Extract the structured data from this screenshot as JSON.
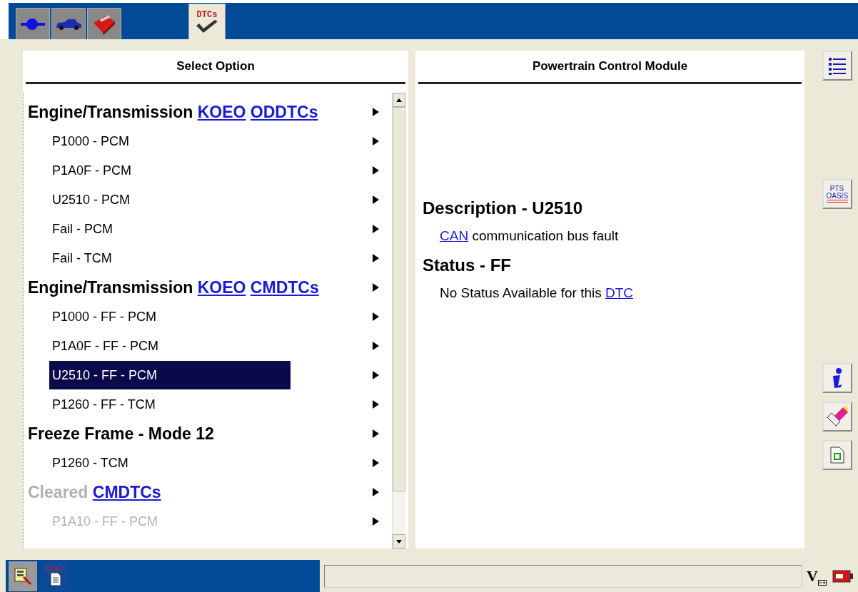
{
  "tabs": [
    {
      "kind": "connector",
      "selected": false
    },
    {
      "kind": "car",
      "selected": false
    },
    {
      "kind": "toolbox",
      "selected": false
    },
    {
      "kind": "dtc",
      "selected": true,
      "label": "DTCs"
    }
  ],
  "left_panel": {
    "title": "Select Option",
    "rows": [
      {
        "kind": "header",
        "disabled": false,
        "selected": false,
        "parts": [
          {
            "kind": "text",
            "text": "Engine/Transmission"
          },
          {
            "kind": "link",
            "text": "KOEO"
          },
          {
            "kind": "link",
            "text": "ODDTCs"
          }
        ]
      },
      {
        "kind": "item",
        "disabled": false,
        "selected": false,
        "parts": [
          {
            "kind": "text",
            "text": "P1000 - PCM"
          }
        ]
      },
      {
        "kind": "item",
        "disabled": false,
        "selected": false,
        "parts": [
          {
            "kind": "text",
            "text": "P1A0F - PCM"
          }
        ]
      },
      {
        "kind": "item",
        "disabled": false,
        "selected": false,
        "parts": [
          {
            "kind": "text",
            "text": "U2510 - PCM"
          }
        ]
      },
      {
        "kind": "item",
        "disabled": false,
        "selected": false,
        "parts": [
          {
            "kind": "text",
            "text": "Fail - PCM"
          }
        ]
      },
      {
        "kind": "item",
        "disabled": false,
        "selected": false,
        "parts": [
          {
            "kind": "text",
            "text": "Fail - TCM"
          }
        ]
      },
      {
        "kind": "header",
        "disabled": false,
        "selected": false,
        "parts": [
          {
            "kind": "text",
            "text": "Engine/Transmission"
          },
          {
            "kind": "link",
            "text": "KOEO"
          },
          {
            "kind": "link",
            "text": "CMDTCs"
          }
        ]
      },
      {
        "kind": "item",
        "disabled": false,
        "selected": false,
        "parts": [
          {
            "kind": "text",
            "text": "P1000 - FF - PCM"
          }
        ]
      },
      {
        "kind": "item",
        "disabled": false,
        "selected": false,
        "parts": [
          {
            "kind": "text",
            "text": "P1A0F - FF - PCM"
          }
        ]
      },
      {
        "kind": "item",
        "disabled": false,
        "selected": true,
        "parts": [
          {
            "kind": "text",
            "text": "U2510 - FF - PCM"
          }
        ]
      },
      {
        "kind": "item",
        "disabled": false,
        "selected": false,
        "parts": [
          {
            "kind": "text",
            "text": "P1260 - FF - TCM"
          }
        ]
      },
      {
        "kind": "header",
        "disabled": false,
        "selected": false,
        "parts": [
          {
            "kind": "text",
            "text": "Freeze Frame - Mode 12"
          }
        ]
      },
      {
        "kind": "item",
        "disabled": false,
        "selected": false,
        "parts": [
          {
            "kind": "text",
            "text": "P1260 - TCM"
          }
        ]
      },
      {
        "kind": "header",
        "disabled": true,
        "selected": false,
        "parts": [
          {
            "kind": "text",
            "text": "Cleared"
          },
          {
            "kind": "link",
            "text": "CMDTCs"
          }
        ]
      },
      {
        "kind": "item",
        "disabled": true,
        "selected": false,
        "parts": [
          {
            "kind": "text",
            "text": "P1A10 - FF - PCM"
          }
        ]
      }
    ]
  },
  "right_panel": {
    "title": "Powertrain Control Module",
    "blocks": [
      {
        "kind": "heading",
        "parts": [
          {
            "kind": "text",
            "text": "Description - U2510"
          }
        ]
      },
      {
        "kind": "body",
        "parts": [
          {
            "kind": "link",
            "text": "CAN"
          },
          {
            "kind": "text",
            "text": "communication bus fault"
          }
        ]
      },
      {
        "kind": "heading",
        "parts": [
          {
            "kind": "text",
            "text": "Status - FF"
          }
        ]
      },
      {
        "kind": "body",
        "parts": [
          {
            "kind": "text",
            "text": "No Status Available for this"
          },
          {
            "kind": "link",
            "text": "DTC"
          }
        ]
      }
    ]
  },
  "side_buttons": [
    {
      "kind": "list"
    },
    {
      "kind": "pts",
      "label": "PTS OASIS"
    },
    {
      "kind": "info"
    },
    {
      "kind": "eraser"
    },
    {
      "kind": "document"
    }
  ],
  "bottom_bar": {
    "buttons": [
      {
        "kind": "tool",
        "selected": true
      },
      {
        "kind": "koeo",
        "label": "KOEO",
        "selected": false
      }
    ],
    "status": {
      "label": "V"
    }
  }
}
